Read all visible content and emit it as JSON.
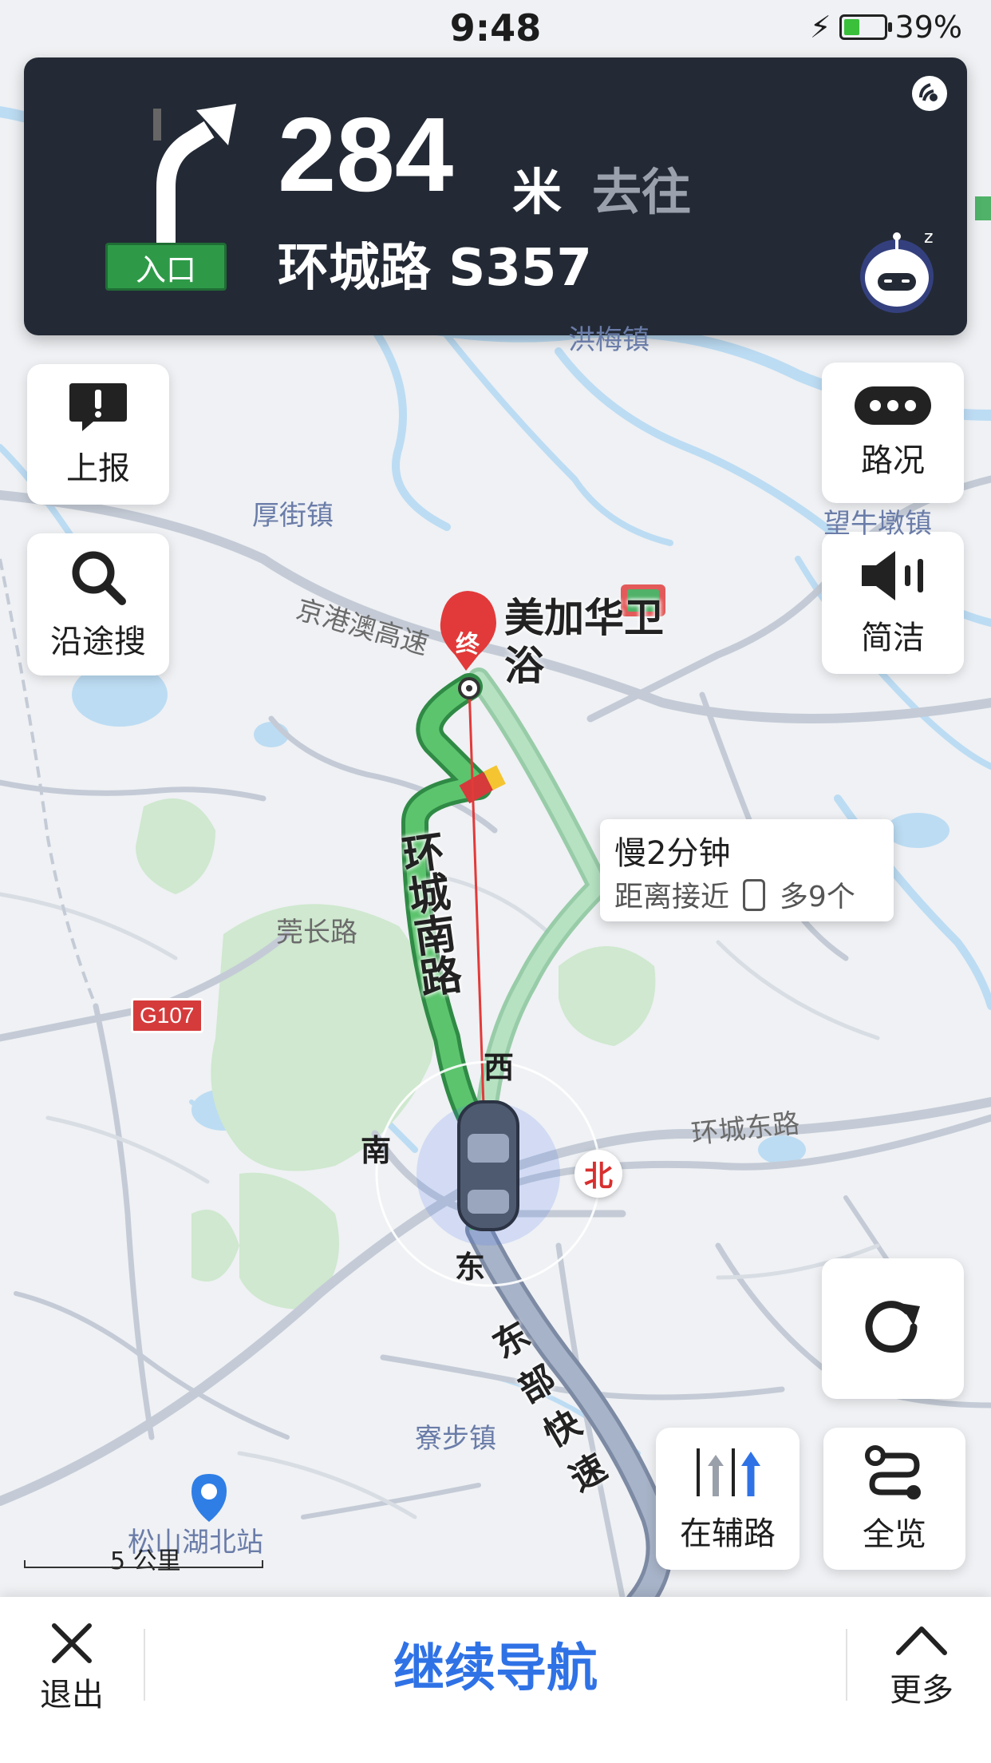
{
  "status_bar": {
    "time": "9:48",
    "battery": "39%",
    "battery_level": 0.39
  },
  "guidance": {
    "distance": "284",
    "unit": "米",
    "goto": "去往",
    "road": "环城路 S357",
    "entry_badge": "入口",
    "turn_icon": "bear-right-arrow-icon"
  },
  "left_buttons": {
    "report": "上报",
    "search_along": "沿途搜"
  },
  "right_buttons": {
    "traffic": "路况",
    "concise": "简洁",
    "refresh_icon": "refresh-icon",
    "side_road": "在辅路",
    "overview": "全览"
  },
  "map": {
    "places": [
      "厚街镇",
      "望牛墩镇",
      "洪梅镇",
      "莞长路",
      "寮步镇",
      "松山湖北站",
      "环城东路",
      "京港澳高速"
    ],
    "route_names": [
      "环城南路",
      "东部快速"
    ],
    "destination": "美加华卫浴",
    "destination_marker": "终",
    "highway_tag": "G107",
    "compass": {
      "west": "西",
      "south": "南",
      "east": "东",
      "north": "北"
    }
  },
  "alt_route": {
    "slower": "慢2分钟",
    "detail": "距离接近",
    "lights": "多9个"
  },
  "scale": {
    "label": "5 公里"
  },
  "bottom_bar": {
    "exit": "退出",
    "continue": "继续导航",
    "more": "更多"
  },
  "colors": {
    "route_green": "#4fc062",
    "route_alt": "#a5d9b4",
    "accent_blue": "#2f72e6",
    "panel": "#232a35"
  }
}
